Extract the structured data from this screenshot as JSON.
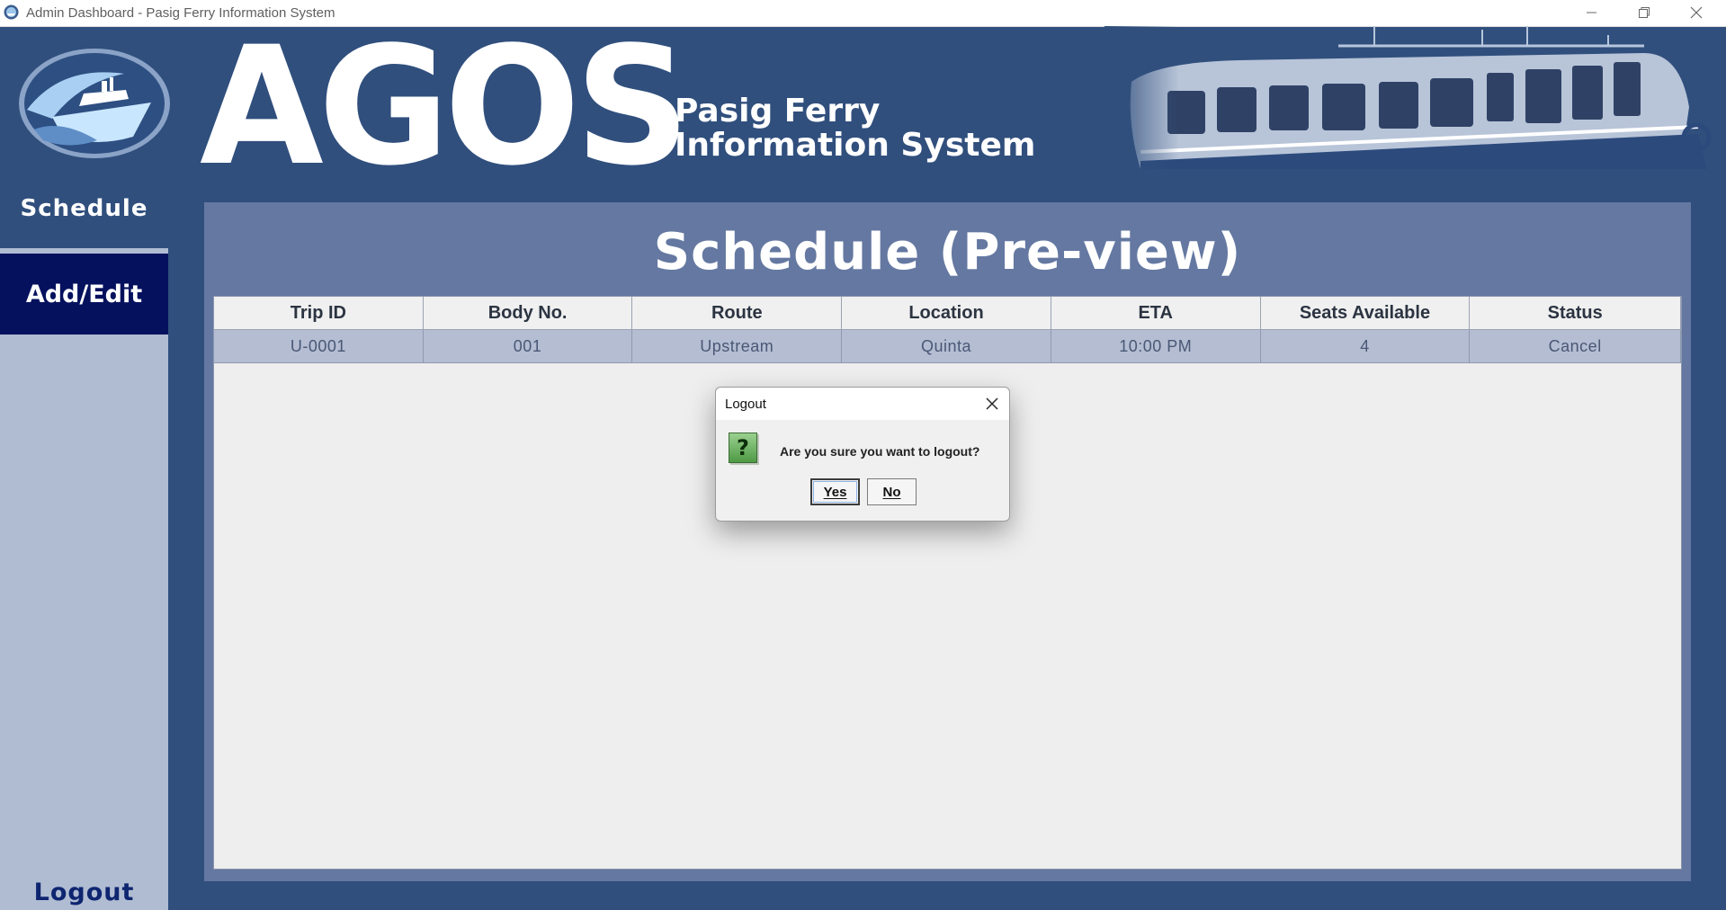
{
  "window": {
    "title": "Admin Dashboard - Pasig Ferry Information System",
    "controls": [
      "minimize-icon",
      "maximize-icon",
      "close-icon"
    ]
  },
  "header": {
    "brand_title": "AGOS",
    "subtitle_line1": "Pasig Ferry",
    "subtitle_line2": "Information System",
    "logo_icon": "ferry-logo-icon",
    "banner_image": "ferry-boat-image"
  },
  "sidebar": {
    "items": [
      {
        "label": "Schedule"
      },
      {
        "label": "Add/Edit"
      }
    ],
    "logout_label": "Logout"
  },
  "main": {
    "page_title": "Schedule (Pre-view)",
    "table": {
      "columns": [
        "Trip ID",
        "Body No.",
        "Route",
        "Location",
        "ETA",
        "Seats Available",
        "Status"
      ],
      "rows": [
        [
          "U-0001",
          "001",
          "Upstream",
          "Quinta",
          "10:00 PM",
          "4",
          "Cancel"
        ]
      ]
    }
  },
  "dialog": {
    "title": "Logout",
    "message": "Are you sure you want to logout?",
    "icon": "question-icon",
    "icon_glyph": "?",
    "yes_label": "Yes",
    "no_label": "No"
  },
  "colors": {
    "background": "#304f7d",
    "panel": "#6478a1",
    "sidebar": "#b0bcd2",
    "active_nav": "#06115e",
    "row": "#b4bdd2"
  }
}
